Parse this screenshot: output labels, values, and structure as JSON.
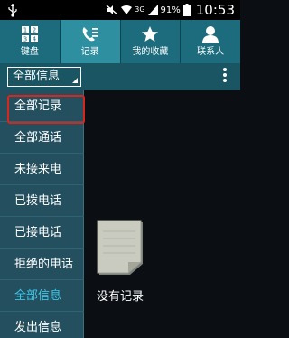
{
  "status_bar": {
    "signal_type": "3G",
    "battery": "91%",
    "time": "10:53"
  },
  "tabs": [
    {
      "label": "键盘",
      "icon": "keypad-icon",
      "active": false
    },
    {
      "label": "记录",
      "icon": "call-log-icon",
      "active": true
    },
    {
      "label": "我的收藏",
      "icon": "star-icon",
      "active": false
    },
    {
      "label": "联系人",
      "icon": "contact-icon",
      "active": false
    }
  ],
  "toolbar": {
    "filter_selected": "全部信息",
    "more_icon": "more-options-icon"
  },
  "menu": {
    "items": [
      {
        "label": "全部记录",
        "highlighted": true
      },
      {
        "label": "全部通话"
      },
      {
        "label": "未接来电"
      },
      {
        "label": "已拨电话"
      },
      {
        "label": "已接电话"
      },
      {
        "label": "拒绝的电话"
      },
      {
        "label": "全部信息",
        "active": true
      },
      {
        "label": "发出信息"
      }
    ]
  },
  "empty_state": {
    "icon": "empty-notes-icon",
    "text": "没有记录"
  },
  "colors": {
    "tab_bar": "#1c6c7e",
    "tab_active": "#2e8fa1",
    "menu_bg": "#234f5e",
    "active_text": "#3fc6e8",
    "highlight_border": "#d7261e"
  }
}
